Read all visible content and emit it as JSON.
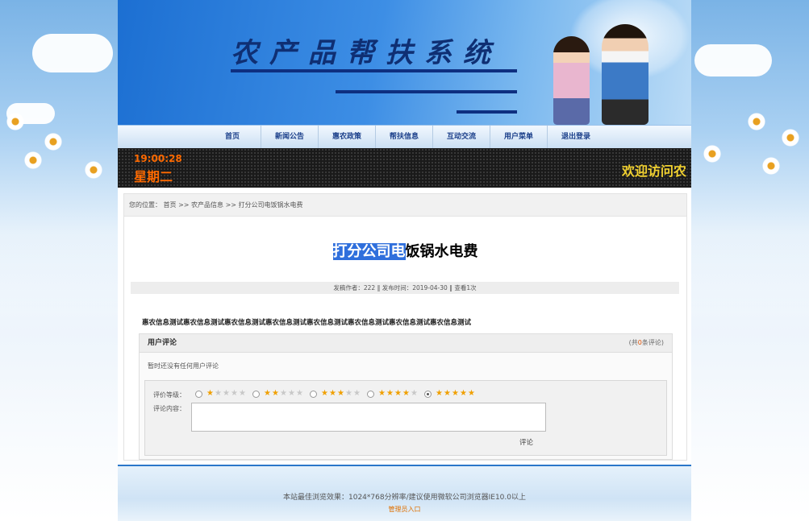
{
  "site": {
    "title": "农产品帮扶系统"
  },
  "nav": {
    "items": [
      {
        "label": "首页"
      },
      {
        "label": "新闻公告"
      },
      {
        "label": "惠农政策"
      },
      {
        "label": "帮扶信息"
      },
      {
        "label": "互动交流"
      },
      {
        "label": "用户菜单"
      },
      {
        "label": "退出登录"
      }
    ]
  },
  "led": {
    "time": "19:00:28",
    "weekday": "星期二",
    "welcome": "欢迎访问农"
  },
  "breadcrumb": {
    "text": "您的位置： 首页 >> 农产品信息 >> 打分公司电饭锅水电费"
  },
  "article": {
    "title_selected": "打分公司电",
    "title_rest": "饭锅水电费",
    "meta": "发稿作者：222  ‖  发布时间：2019-04-30  ‖  查看1次",
    "body": "惠农信息测试惠农信息测试惠农信息测试惠农信息测试惠农信息测试惠农信息测试惠农信息测试惠农信息测试"
  },
  "comments": {
    "title": "用户评论",
    "count_prefix": "(共",
    "count": "0",
    "count_suffix": "条评论)",
    "empty_text": "暂时还没有任何用户评论",
    "rating_label": "评价等级：",
    "content_label": "评论内容：",
    "submit_label": "评论",
    "ratings": [
      {
        "stars": 1,
        "checked": false
      },
      {
        "stars": 2,
        "checked": false
      },
      {
        "stars": 3,
        "checked": false
      },
      {
        "stars": 4,
        "checked": false
      },
      {
        "stars": 5,
        "checked": true
      }
    ]
  },
  "footer": {
    "note": "本站最佳浏览效果：1024*768分辨率/建议使用微软公司浏览器IE10.0以上",
    "admin_link": "管理员入口"
  }
}
